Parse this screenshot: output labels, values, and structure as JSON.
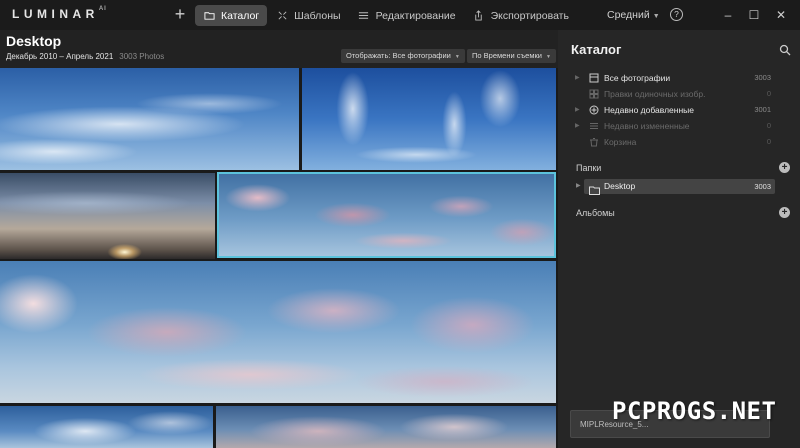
{
  "app": {
    "logo_text": "LUMINAR",
    "logo_sup": "AI"
  },
  "topbar": {
    "add_icon": "plus-icon",
    "tabs": [
      {
        "label": "Каталог",
        "icon": "folder-icon",
        "active": true
      },
      {
        "label": "Шаблоны",
        "icon": "templates-icon",
        "active": false
      },
      {
        "label": "Редактирование",
        "icon": "sliders-icon",
        "active": false
      },
      {
        "label": "Экспортировать",
        "icon": "share-icon",
        "active": false
      }
    ],
    "quality": "Средний",
    "help": "?",
    "window": {
      "minimize": "–",
      "maximize": "☐",
      "close": "✕"
    }
  },
  "gallery": {
    "title": "Desktop",
    "date_range": "Декабрь 2010 – Апрель 2021",
    "photo_count": "3003 Photos",
    "filter_dropdown": "Отображать: Все фотографии",
    "sort_dropdown": "По Времени съемки",
    "photos": [
      {
        "name": "blue-sky-altocumulus"
      },
      {
        "name": "cirrus-streaks"
      },
      {
        "name": "sunset-horizon"
      },
      {
        "name": "pink-clouds",
        "selected": true
      },
      {
        "name": "pink-clouds-wide"
      },
      {
        "name": "blue-clouds-bottom"
      },
      {
        "name": "pink-clouds-bottom"
      }
    ]
  },
  "panel": {
    "title": "Каталог",
    "catalog_items": [
      {
        "label": "Все фотографии",
        "count": "3003",
        "enabled": true,
        "icon": "all-photos-icon"
      },
      {
        "label": "Правки одиночных изобр.",
        "count": "0",
        "enabled": false,
        "icon": "single-edits-icon"
      },
      {
        "label": "Недавно добавленные",
        "count": "3001",
        "enabled": true,
        "icon": "recently-added-icon"
      },
      {
        "label": "Недавно измененные",
        "count": "0",
        "enabled": false,
        "icon": "recently-edited-icon"
      },
      {
        "label": "Корзина",
        "count": "0",
        "enabled": false,
        "icon": "trash-icon"
      }
    ],
    "folders_label": "Папки",
    "folder": {
      "label": "Desktop",
      "count": "3003"
    },
    "albums_label": "Альбомы"
  },
  "tooltip": {
    "text": "MIPLResource_5..."
  },
  "watermark": "PCPROGS.NET"
}
